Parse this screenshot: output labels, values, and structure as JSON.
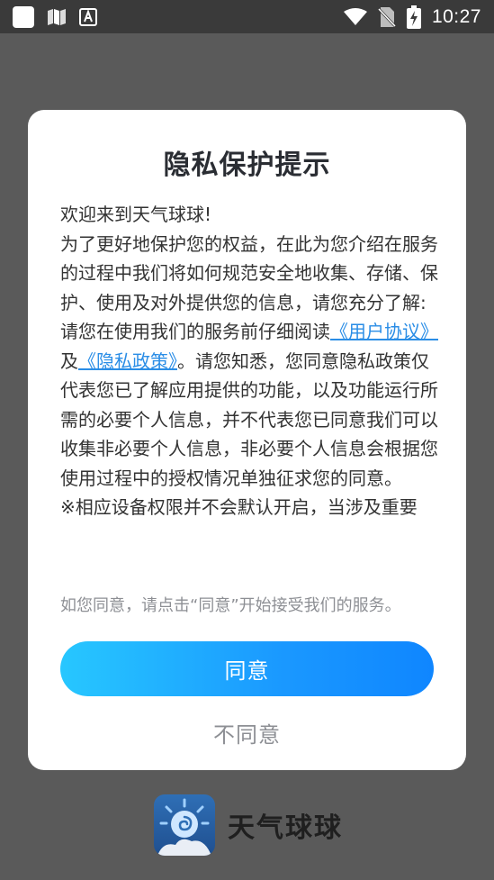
{
  "status_bar": {
    "time": "10:27",
    "left_icons": [
      "app-square-icon",
      "book-icon",
      "font-a-icon"
    ],
    "right_icons": [
      "wifi-icon",
      "no-sim-icon",
      "battery-charging-icon"
    ]
  },
  "dialog": {
    "title": "隐私保护提示",
    "body": {
      "p1": "欢迎来到天气球球!",
      "p2": "为了更好地保护您的权益，在此为您介绍在服务的过程中我们将如何规范安全地收集、存储、保护、使用及对外提供您的信息，请您充分了解:",
      "p3_before": "请您在使用我们的服务前仔细阅读",
      "user_agreement_link": "《用户协议》",
      "p3_and": "及",
      "privacy_policy_link": "《隐私政策》",
      "p3_after": "。请您知悉，您同意隐私政策仅代表您已了解应用提供的功能，以及功能运行所需的必要个人信息，并不代表您已同意我们可以收集非必要个人信息，非必要个人信息会根据您使用过程中的授权情况单独征求您的同意。",
      "p4": "※相应设备权限并不会默认开启，当涉及重要"
    },
    "consent_hint": "如您同意，请点击“同意”开始接受我们的服务。",
    "agree_label": "同意",
    "disagree_label": "不同意"
  },
  "brand": {
    "name": "天气球球",
    "logo_icon": "weather-ball-logo-icon"
  },
  "colors": {
    "link": "#2a8de6",
    "button_gradient_start": "#27c7ff",
    "button_gradient_end": "#0f86ff",
    "overlay": "#5a5a5a"
  }
}
